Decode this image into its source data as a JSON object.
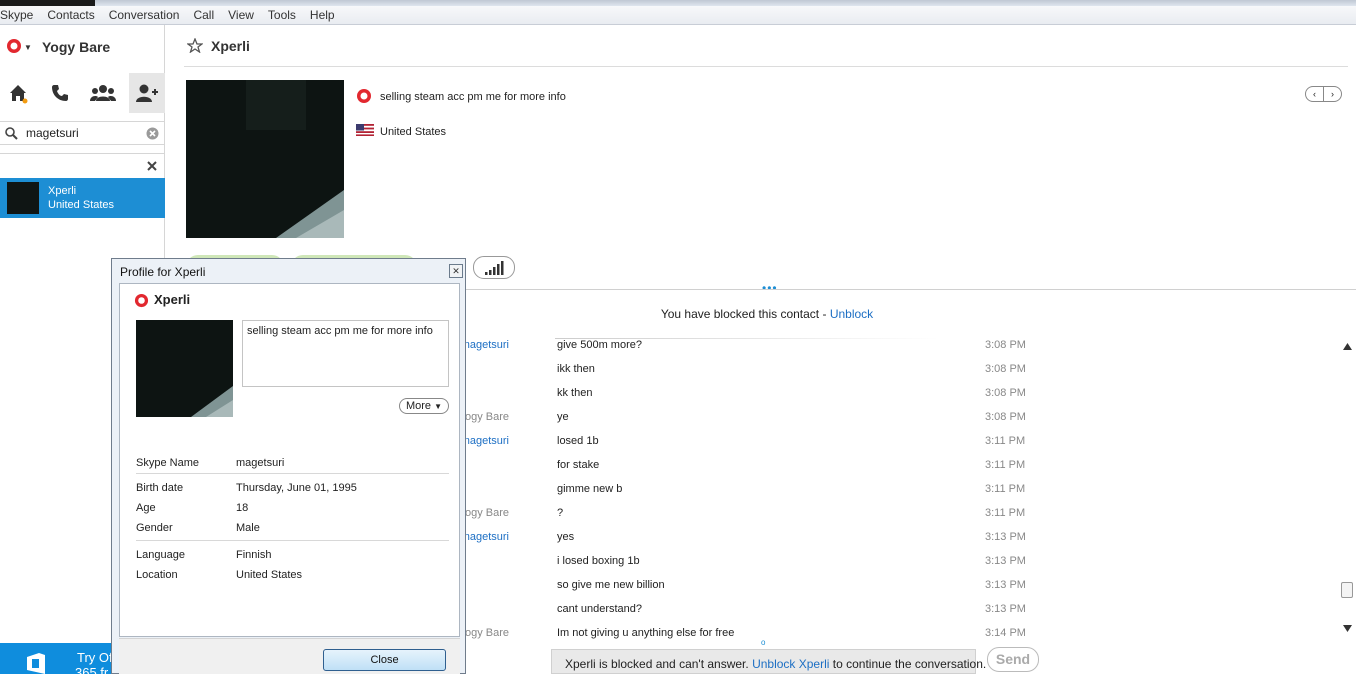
{
  "menu": [
    "Skype",
    "Contacts",
    "Conversation",
    "Call",
    "View",
    "Tools",
    "Help"
  ],
  "user": {
    "name": "Yogy Bare"
  },
  "search": {
    "value": "magetsuri"
  },
  "contact_list": [
    {
      "name": "Xperli",
      "location": "United States"
    }
  ],
  "promo": {
    "line1": "Try Of",
    "line2": "365 fr"
  },
  "conversation": {
    "title": "Xperli",
    "mood": "selling steam acc pm me for more info",
    "country": "United States",
    "blocked_notice": "You have blocked this contact - ",
    "unblock_link": "Unblock",
    "messages": [
      {
        "sender": "magetsuri",
        "self": false,
        "text": "give 500m more?",
        "time": "3:08 PM"
      },
      {
        "sender": "",
        "self": false,
        "text": "ikk then",
        "time": "3:08 PM"
      },
      {
        "sender": "",
        "self": false,
        "text": "kk then",
        "time": "3:08 PM"
      },
      {
        "sender": "Yogy Bare",
        "self": true,
        "text": "ye",
        "time": "3:08 PM"
      },
      {
        "sender": "magetsuri",
        "self": false,
        "text": "losed 1b",
        "time": "3:11 PM"
      },
      {
        "sender": "",
        "self": false,
        "text": "for stake",
        "time": "3:11 PM"
      },
      {
        "sender": "",
        "self": false,
        "text": "gimme new b",
        "time": "3:11 PM"
      },
      {
        "sender": "Yogy Bare",
        "self": true,
        "text": "?",
        "time": "3:11 PM"
      },
      {
        "sender": "magetsuri",
        "self": false,
        "text": "yes",
        "time": "3:13 PM"
      },
      {
        "sender": "",
        "self": false,
        "text": "i losed boxing 1b",
        "time": "3:13 PM"
      },
      {
        "sender": "",
        "self": false,
        "text": "so give me new billion",
        "time": "3:13 PM"
      },
      {
        "sender": "",
        "self": false,
        "text": "cant understand?",
        "time": "3:13 PM"
      },
      {
        "sender": "Yogy Bare",
        "self": true,
        "text": "Im not giving u anything else for free",
        "time": "3:14 PM"
      }
    ],
    "blockbar": {
      "prefix": "Xperli is blocked and can't answer. ",
      "link": "Unblock Xperli",
      "suffix": " to continue the conversation."
    },
    "send_label": "Send"
  },
  "profile_dialog": {
    "title": "Profile for Xperli",
    "name": "Xperli",
    "mood": "selling steam acc pm me for more info",
    "more_label": "More",
    "fields": {
      "skype_name": {
        "label": "Skype Name",
        "value": "magetsuri"
      },
      "birth_date": {
        "label": "Birth date",
        "value": "Thursday, June 01, 1995"
      },
      "age": {
        "label": "Age",
        "value": "18"
      },
      "gender": {
        "label": "Gender",
        "value": "Male"
      },
      "language": {
        "label": "Language",
        "value": "Finnish"
      },
      "location": {
        "label": "Location",
        "value": "United States"
      }
    },
    "close_label": "Close"
  },
  "colors": {
    "accent": "#1d8ed4",
    "link": "#1d6fc4",
    "skype_red": "#e2282f"
  }
}
